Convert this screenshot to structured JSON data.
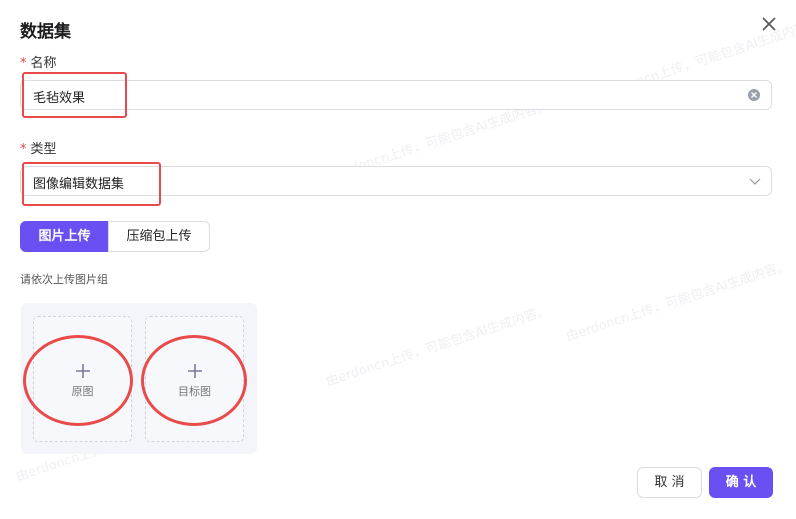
{
  "dialog": {
    "title": "数据集"
  },
  "name_field": {
    "label": "名称",
    "required_mark": "*",
    "value": "毛毡效果"
  },
  "type_field": {
    "label": "类型",
    "required_mark": "*",
    "value": "图像编辑数据集"
  },
  "upload_tabs": {
    "active": "图片上传",
    "inactive": "压缩包上传"
  },
  "hint": "请依次上传图片组",
  "slots": [
    {
      "plus": "+",
      "label": "原图"
    },
    {
      "plus": "+",
      "label": "目标图"
    }
  ],
  "buttons": {
    "cancel": "取 消",
    "ok": "确 认"
  },
  "icons": {
    "close": "close-icon",
    "clear": "clear-icon",
    "chevron": "chevron-down-icon",
    "plus": "plus-icon"
  },
  "colors": {
    "accent": "#6a4ff2",
    "annotation": "#e94b4b",
    "required": "#e5484d"
  },
  "watermark": "由erdoncn上传，可能包含AI生成内容。"
}
